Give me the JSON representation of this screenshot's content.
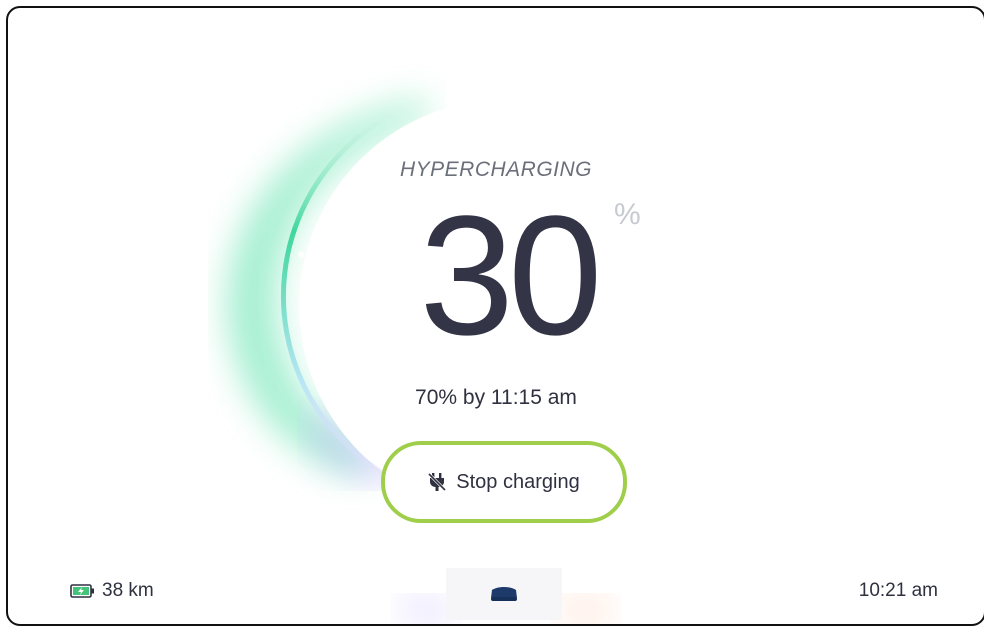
{
  "charging": {
    "mode": "HYPERCHARGING",
    "level": "30",
    "unit": "%",
    "level_fraction": 0.3,
    "eta": "70% by 11:15 am"
  },
  "actions": {
    "stop_label": "Stop charging"
  },
  "status_bar": {
    "range": "38 km",
    "time": "10:21 am"
  },
  "icons": {
    "plug": "unplug-icon",
    "battery": "battery-charging-icon",
    "car": "car-icon"
  },
  "colors": {
    "accent_green": "#9fcf4a",
    "charge_gradient_start": "#2ed89a",
    "charge_gradient_end": "#c9b6ff",
    "text_dark": "#333547"
  }
}
